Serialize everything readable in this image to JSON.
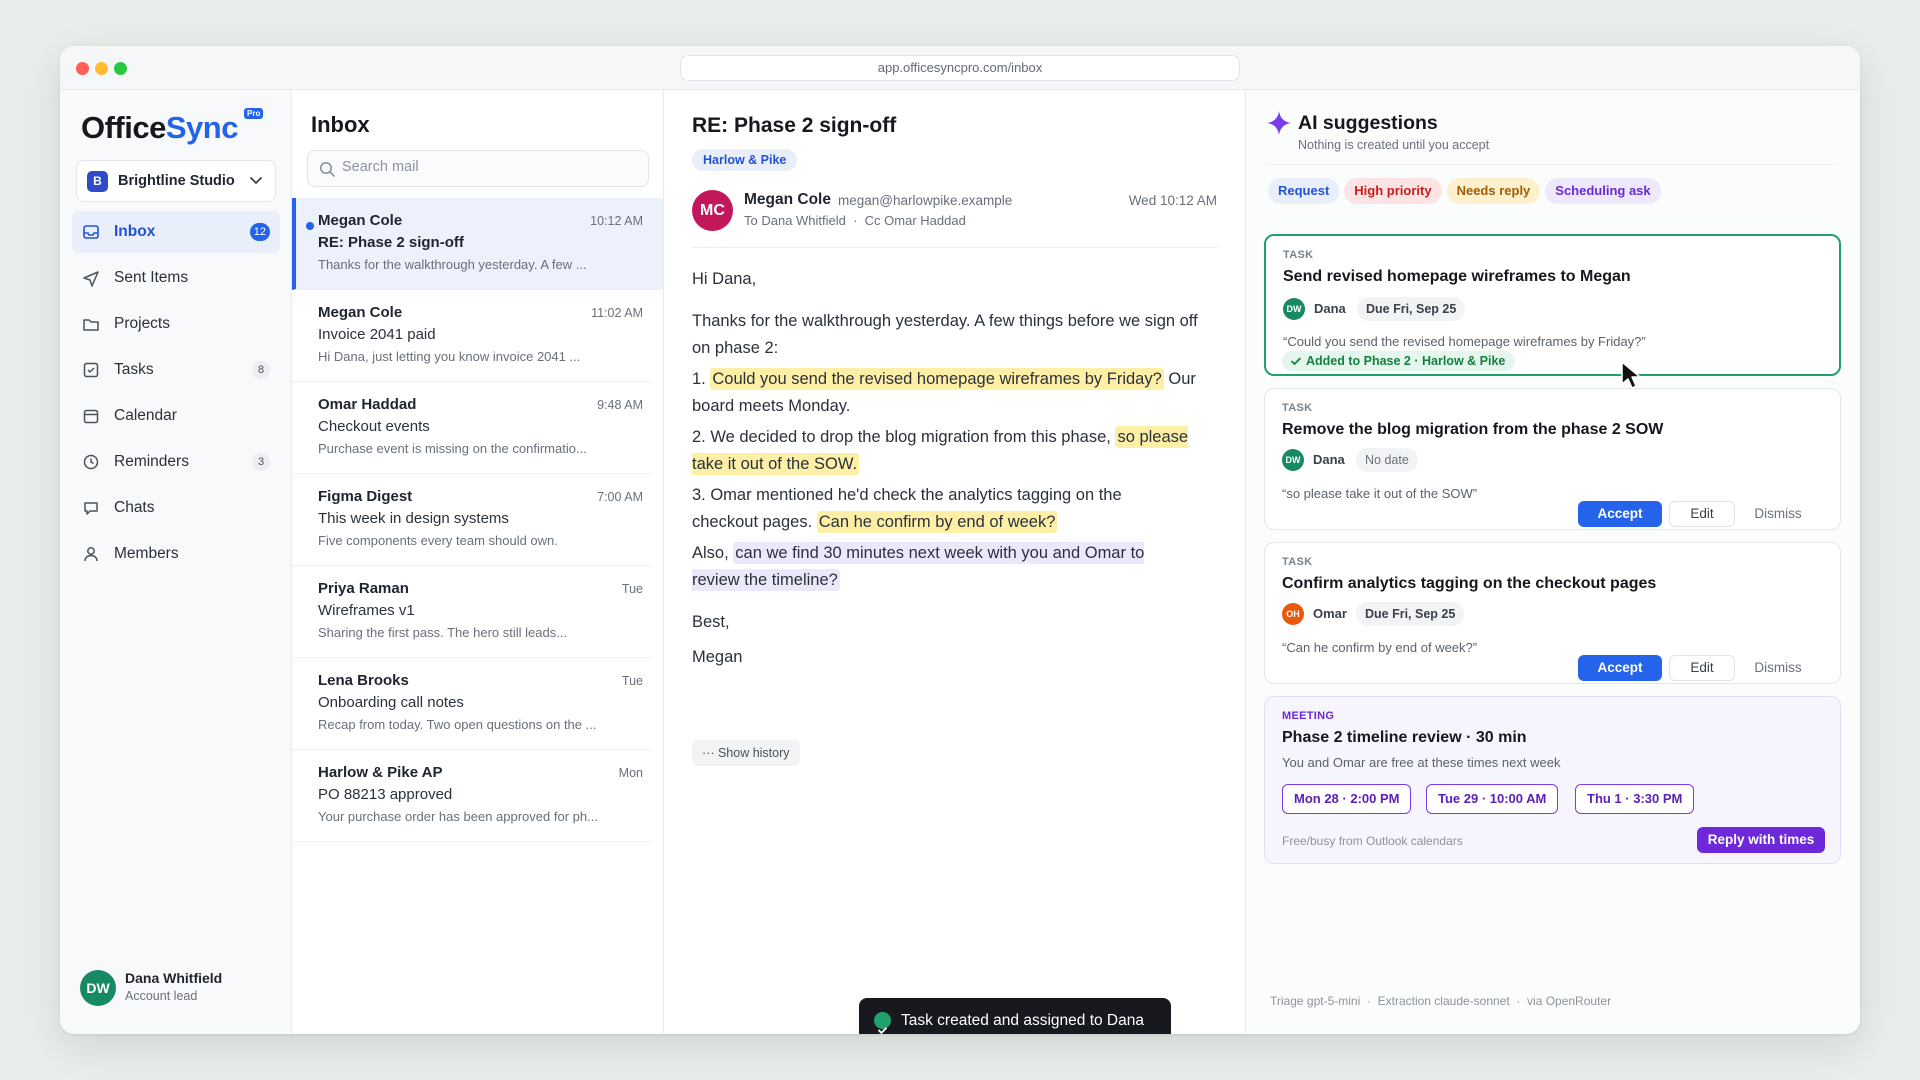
{
  "browser": {
    "url": "app.officesyncpro.com/inbox",
    "colors": {
      "close": "#ff5f57",
      "min": "#febc2e",
      "max": "#28c840"
    }
  },
  "brand": {
    "name_a": "Office",
    "name_b": "Sync",
    "badge": "Pro",
    "accent": "#2563eb"
  },
  "workspace": {
    "initial": "B",
    "name": "Brightline Studio"
  },
  "nav": [
    {
      "label": "Inbox",
      "count": "12",
      "icon": "inbox-icon"
    },
    {
      "label": "Sent Items",
      "count": "",
      "icon": "send-icon"
    },
    {
      "label": "Projects",
      "count": "",
      "icon": "folder-icon"
    },
    {
      "label": "Tasks",
      "count": "8",
      "icon": "checkbox-icon"
    },
    {
      "label": "Calendar",
      "count": "",
      "icon": "calendar-icon"
    },
    {
      "label": "Reminders",
      "count": "3",
      "icon": "clock-icon"
    },
    {
      "label": "Chats",
      "count": "",
      "icon": "chat-icon"
    },
    {
      "label": "Members",
      "count": "",
      "icon": "person-icon"
    }
  ],
  "user": {
    "initials": "DW",
    "name": "Dana Whitfield",
    "role": "Account lead"
  },
  "inbox": {
    "title": "Inbox",
    "search_placeholder": "Search mail",
    "messages": [
      {
        "from": "Megan Cole",
        "time": "10:12 AM",
        "subject": "RE: Phase 2 sign-off",
        "snippet": "Thanks for the walkthrough yesterday. A few ..."
      },
      {
        "from": "Megan Cole",
        "time": "11:02 AM",
        "subject": "Invoice 2041 paid",
        "snippet": "Hi Dana, just letting you know invoice 2041 ..."
      },
      {
        "from": "Omar Haddad",
        "time": "9:48 AM",
        "subject": "Checkout events",
        "snippet": "Purchase event is missing on the confirmatio..."
      },
      {
        "from": "Figma Digest",
        "time": "7:00 AM",
        "subject": "This week in design systems",
        "snippet": "Five components every team should own."
      },
      {
        "from": "Priya Raman",
        "time": "Tue",
        "subject": "Wireframes v1",
        "snippet": "Sharing the first pass. The hero still leads..."
      },
      {
        "from": "Lena Brooks",
        "time": "Tue",
        "subject": "Onboarding call notes",
        "snippet": "Recap from today. Two open questions on the ..."
      },
      {
        "from": "Harlow & Pike AP",
        "time": "Mon",
        "subject": "PO 88213 approved",
        "snippet": "Your purchase order has been approved for ph..."
      }
    ]
  },
  "reader": {
    "subject": "RE: Phase 2 sign-off",
    "tag": "Harlow & Pike",
    "sender_initials": "MC",
    "sender_name": "Megan Cole",
    "sender_email": "megan@harlowpike.example",
    "to_line": "To Dana Whitfield",
    "cc_line": "Cc Omar Haddad",
    "date": "Wed 10:12 AM",
    "greeting": "Hi Dana,",
    "p1": "Thanks for the walkthrough yesterday. A few things before we sign off on phase 2:",
    "i1_num": "1.",
    "i1_hl": "Could you send the revised homepage wireframes by Friday?",
    "i1_rest": "Our board meets Monday.",
    "i2_pre": "2. We decided to drop the blog migration from this phase,",
    "i2_hl": "so please take it out of the SOW.",
    "i3_pre": "3. Omar mentioned he'd check the analytics tagging on the checkout pages.",
    "i3_hl": "Can he confirm by end of week?",
    "also_pre": "Also,",
    "also_hl": "can we find 30 minutes next week with you and Omar to review the timeline?",
    "signoff": "Best,",
    "signature": "Megan",
    "show_history": "··· Show history"
  },
  "toast": {
    "text": "Task created and assigned to Dana"
  },
  "ai": {
    "title": "AI suggestions",
    "subtitle": "Nothing is created until you accept",
    "chips": [
      {
        "label": "Request",
        "bg": "#e9eefb",
        "fg": "#2452d6"
      },
      {
        "label": "High priority",
        "bg": "#fde4e4",
        "fg": "#c81e1e"
      },
      {
        "label": "Needs reply",
        "bg": "#fdf0cc",
        "fg": "#a15c07"
      },
      {
        "label": "Scheduling ask",
        "bg": "#ede8fb",
        "fg": "#6d28d9"
      }
    ],
    "tasks": [
      {
        "kind": "TASK",
        "title": "Send revised homepage wireframes to Megan",
        "assignee_initials": "DW",
        "assignee": "Dana",
        "due": "Due Fri, Sep 25",
        "quote": "“Could you send the revised homepage wireframes by Friday?”",
        "added": "Added to Phase 2 · Harlow & Pike"
      },
      {
        "kind": "TASK",
        "title": "Remove the blog migration from the phase 2 SOW",
        "assignee_initials": "DW",
        "assignee": "Dana",
        "due": "No date",
        "quote": "“so please take it out of the SOW”",
        "accept": "Accept",
        "edit": "Edit",
        "dismiss": "Dismiss"
      },
      {
        "kind": "TASK",
        "title": "Confirm analytics tagging on the checkout pages",
        "assignee_initials": "OH",
        "assignee": "Omar",
        "due": "Due Fri, Sep 25",
        "quote": "“Can he confirm by end of week?”",
        "accept": "Accept",
        "edit": "Edit",
        "dismiss": "Dismiss"
      }
    ],
    "meeting": {
      "kind": "MEETING",
      "title": "Phase 2 timeline review · 30 min",
      "subtitle": "You and Omar are free at these times next week",
      "slots": [
        "Mon 28 · 2:00 PM",
        "Tue 29 · 10:00 AM",
        "Thu 1 · 3:30 PM"
      ],
      "footnote": "Free/busy from Outlook calendars",
      "reply": "Reply with times"
    },
    "footer": {
      "triage": "Triage gpt-5-mini",
      "extraction": "Extraction claude-sonnet",
      "via": "via OpenRouter"
    }
  }
}
